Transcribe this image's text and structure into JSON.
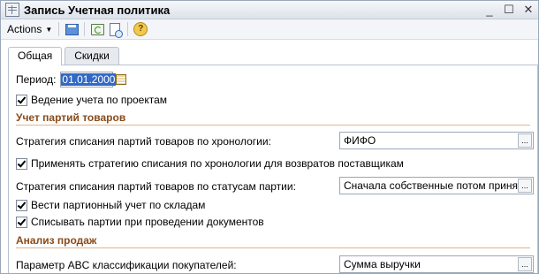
{
  "window": {
    "title": "Запись Учетная политика",
    "min_label": "_",
    "max_label": "☐",
    "close_label": "✕"
  },
  "toolbar": {
    "actions_label": "Actions"
  },
  "tabs": [
    {
      "label": "Общая",
      "active": true
    },
    {
      "label": "Скидки",
      "active": false
    }
  ],
  "form": {
    "period_label": "Период:",
    "period_value": "01.01.2000",
    "projects_checkbox_label": "Ведение учета по проектам",
    "projects_checked": true,
    "section_batches": "Учет партий товаров",
    "strategy_chrono_label": "Стратегия списания партий товаров по хронологии:",
    "strategy_chrono_value": "ФИФО",
    "apply_returns_label": "Применять стратегию списания по хронологии для возвратов поставщикам",
    "apply_returns_checked": true,
    "strategy_status_label": "Стратегия списания партий товаров по статусам партии:",
    "strategy_status_value": "Сначала собственные потом принятые",
    "warehouse_label": "Вести партионный учет по складам",
    "warehouse_checked": true,
    "writeoff_label": "Списывать партии при проведении документов",
    "writeoff_checked": true,
    "section_sales": "Анализ продаж",
    "abc_label": "Параметр ABC классификации покупателей:",
    "abc_value": "Сумма выручки",
    "dots_label": "..."
  }
}
